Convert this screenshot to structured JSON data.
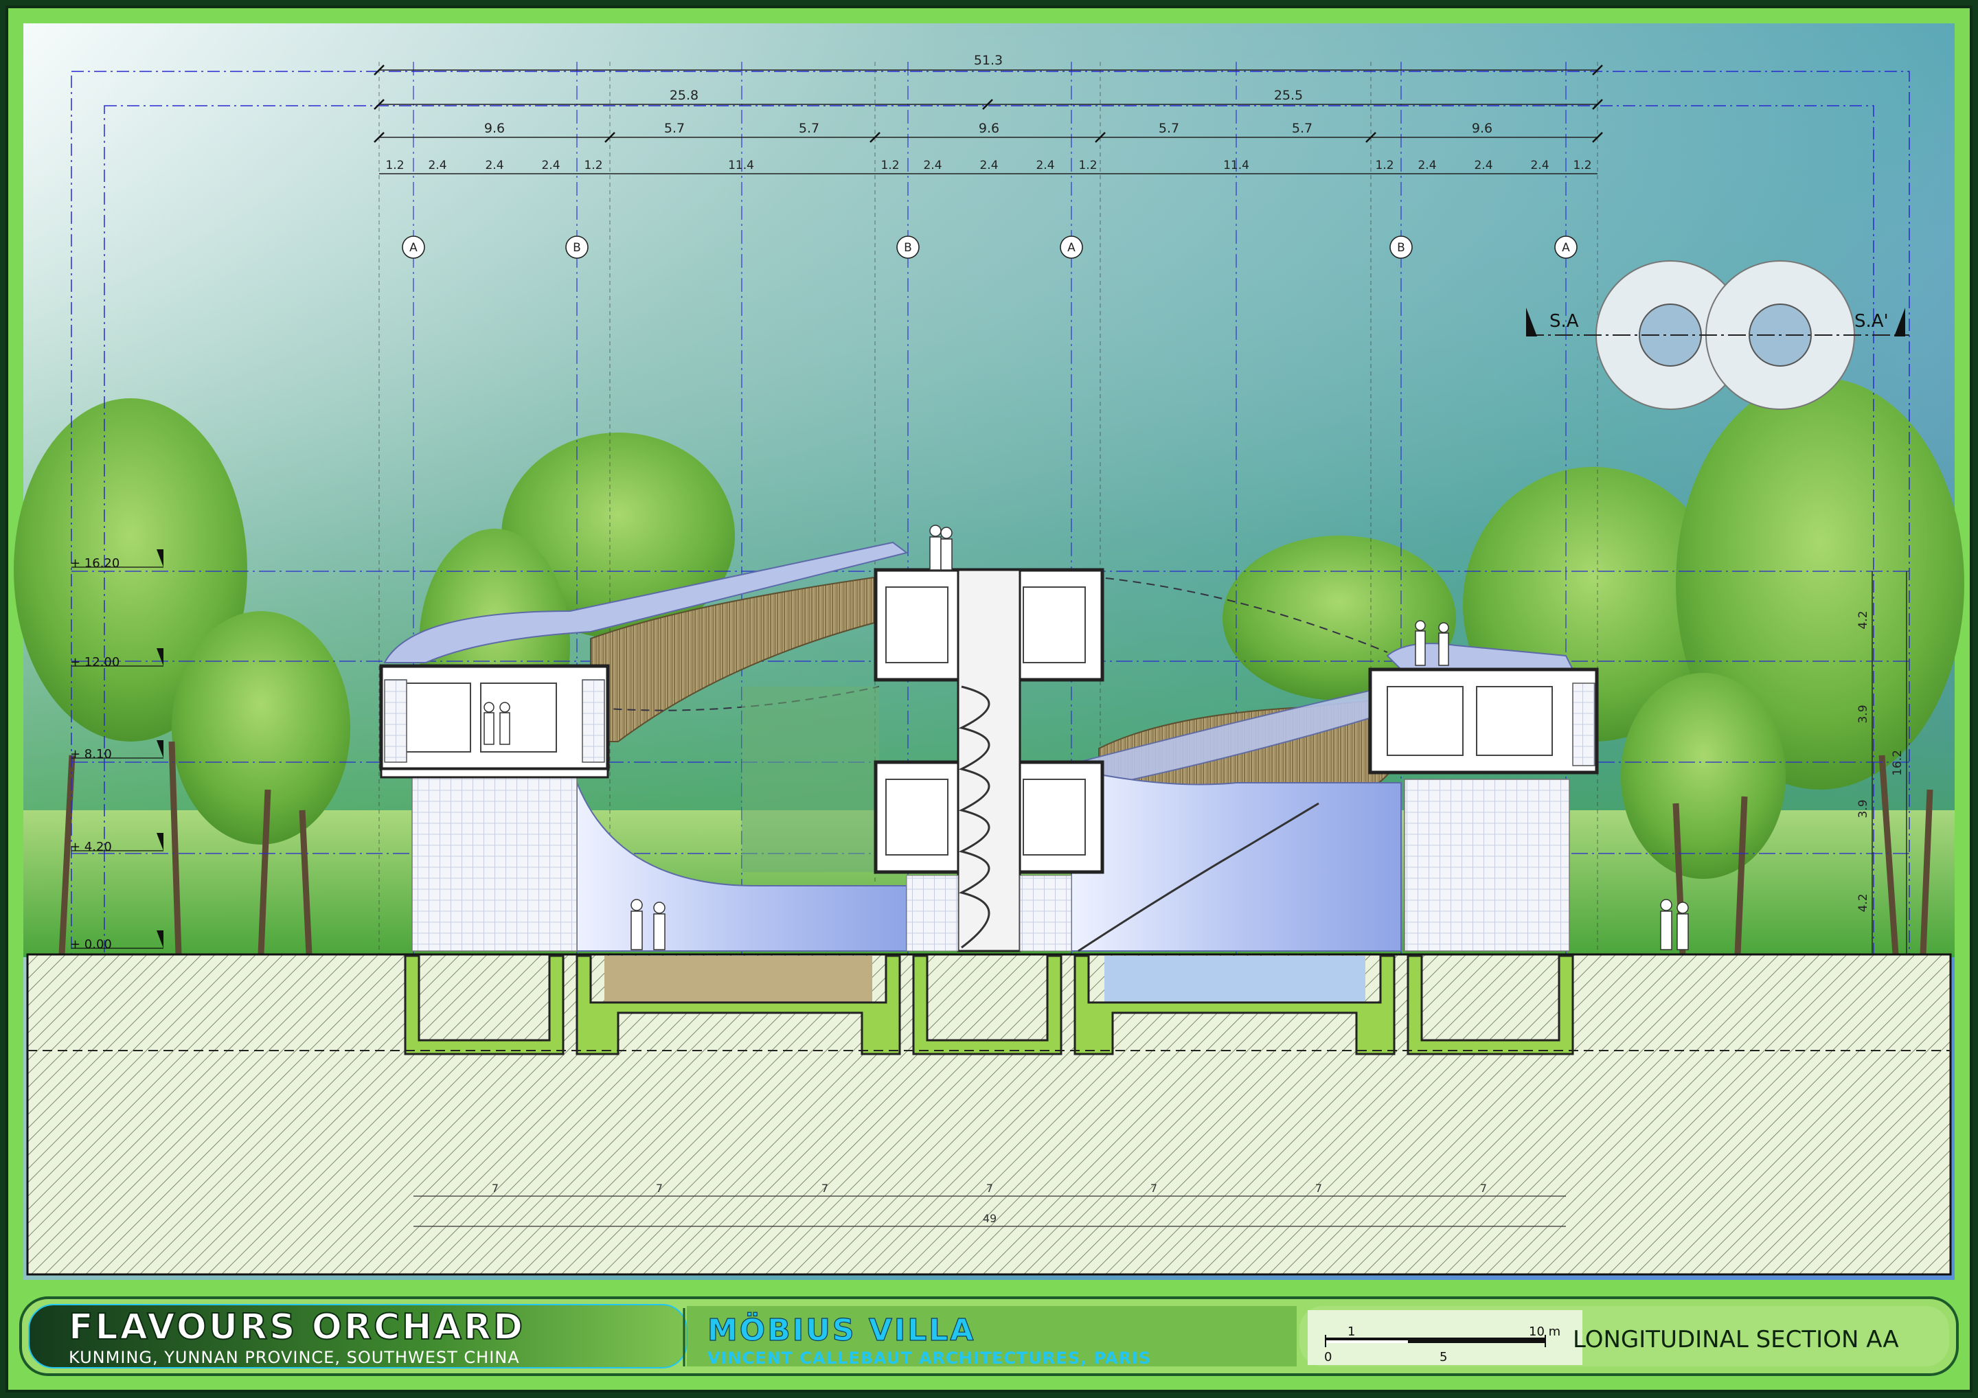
{
  "dims": {
    "overall": "51.3",
    "halves": [
      "25.8",
      "25.5"
    ],
    "segments": [
      "9.6",
      "5.7",
      "5.7",
      "9.6",
      "5.7",
      "5.7",
      "9.6"
    ],
    "modules": [
      "1.2",
      "2.4",
      "2.4",
      "2.4",
      "1.2",
      "11.4",
      "1.2",
      "2.4",
      "2.4",
      "2.4",
      "1.2",
      "11.4",
      "1.2",
      "2.4",
      "2.4",
      "2.4",
      "1.2"
    ],
    "right_side": [
      "4.2",
      "3.9",
      "3.9",
      "4.2"
    ],
    "right_total": "16.2",
    "bottom": [
      "7",
      "7",
      "7",
      "7",
      "7",
      "7",
      "7"
    ],
    "bottom_total": "49"
  },
  "grid_bubbles": [
    "A",
    "B",
    "B",
    "A",
    "B",
    "A"
  ],
  "levels": [
    "+ 16.20",
    "+ 12.00",
    "+ 8.10",
    "+ 4.20",
    "+ 0.00"
  ],
  "key_plan": {
    "left": "S.A",
    "right": "S.A'"
  },
  "title_block": {
    "project": "FLAVOURS ORCHARD",
    "location": "KUNMING, YUNNAN PROVINCE, SOUTHWEST CHINA",
    "building": "MÖBIUS VILLA",
    "architect": "VINCENT CALLEBAUT ARCHITECTURES, PARIS",
    "scale_ticks": [
      "1",
      "10 m",
      "0",
      "5"
    ],
    "drawing_title": "LONGITUDINAL SECTION AA"
  },
  "colors": {
    "frame_green": "#7ed957",
    "frame_dark": "#10351a",
    "grid_blue": "#2a2ad0",
    "ground_hatch": "#e9f2d9",
    "title_cyan": "#22c6f0"
  }
}
